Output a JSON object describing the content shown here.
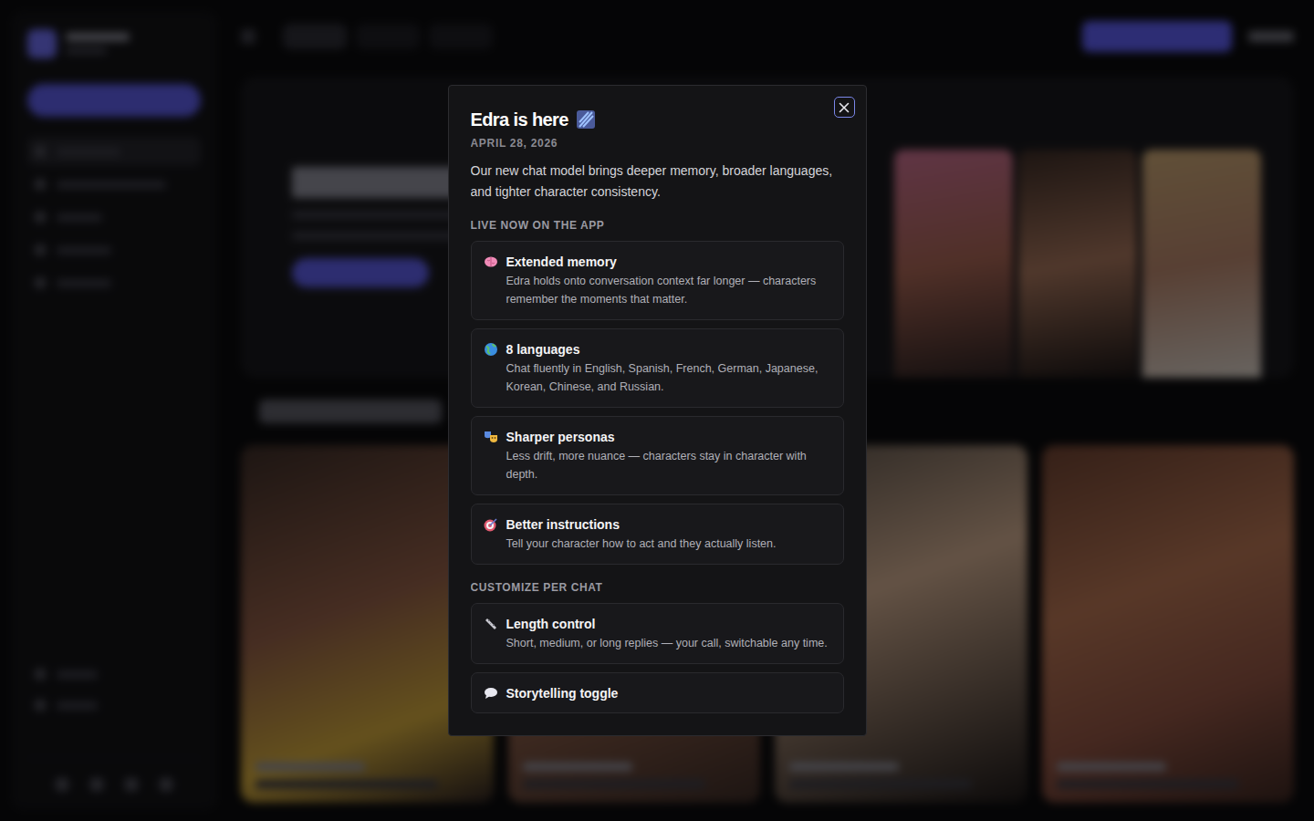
{
  "modal": {
    "title": "Edra is here",
    "date": "APRIL 28, 2026",
    "description": "Our new chat model brings deeper memory, broader languages, and tighter character consistency.",
    "sections": [
      {
        "heading": "LIVE NOW ON THE APP",
        "items": [
          {
            "title": "Extended memory",
            "description": "Edra holds onto conversation context far longer — characters remember the moments that matter."
          },
          {
            "title": "8 languages",
            "description": "Chat fluently in English, Spanish, French, German, Japanese, Korean, Chinese, and Russian."
          },
          {
            "title": "Sharper personas",
            "description": "Less drift, more nuance — characters stay in character with depth."
          },
          {
            "title": "Better instructions",
            "description": "Tell your character how to act and they actually listen."
          }
        ]
      },
      {
        "heading": "CUSTOMIZE PER CHAT",
        "items": [
          {
            "title": "Length control",
            "description": "Short, medium, or long replies — your call, switchable any time."
          },
          {
            "title": "Storytelling toggle"
          }
        ]
      }
    ]
  }
}
